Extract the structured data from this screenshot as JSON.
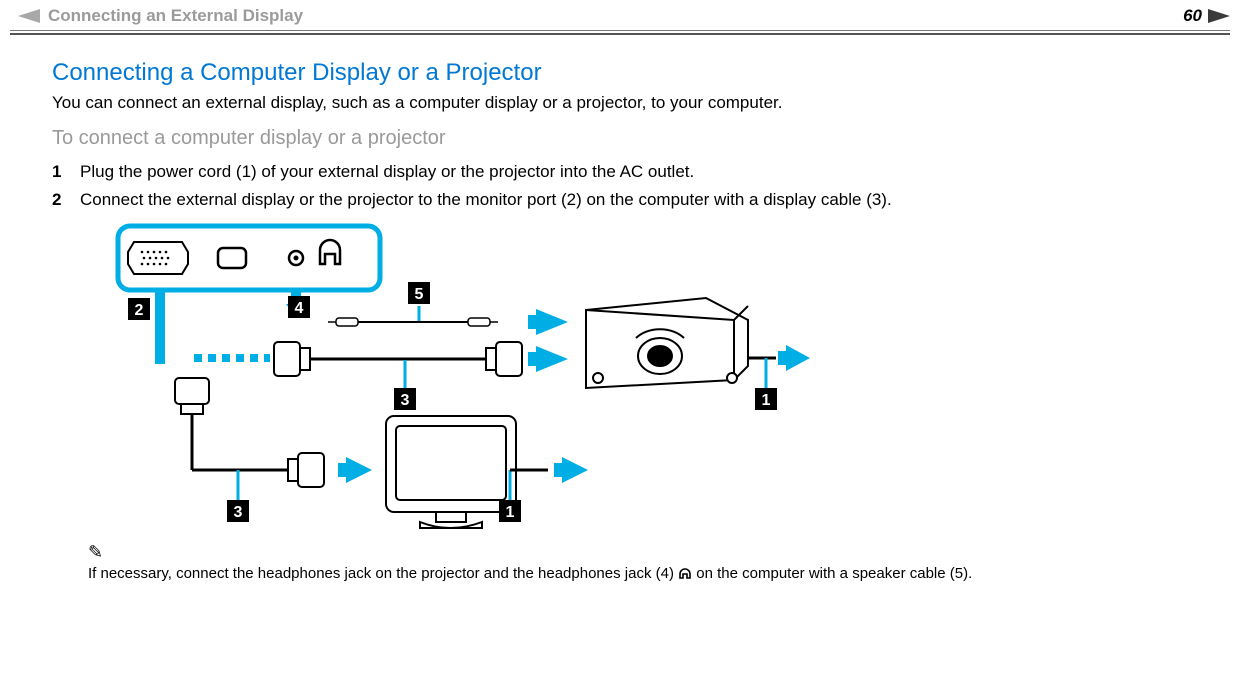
{
  "header": {
    "breadcrumb": "Connecting an External Display",
    "page_number": "60"
  },
  "main": {
    "title": "Connecting a Computer Display or a Projector",
    "intro": "You can connect an external display, such as a computer display or a projector, to your computer.",
    "subhead": "To connect a computer display or a projector",
    "steps": [
      {
        "num": "1",
        "text": "Plug the power cord (1) of your external display or the projector into the AC outlet."
      },
      {
        "num": "2",
        "text": "Connect the external display or the projector to the monitor port (2) on the computer with a display cable (3)."
      }
    ],
    "diagram_labels": {
      "l1": "1",
      "l2": "2",
      "l3": "3",
      "l4": "4",
      "l5": "5"
    },
    "note": {
      "pencil": "✎",
      "pre": "If necessary, connect the headphones jack on the projector and the headphones jack (4) ",
      "post": " on the computer with a speaker cable (5)."
    }
  }
}
